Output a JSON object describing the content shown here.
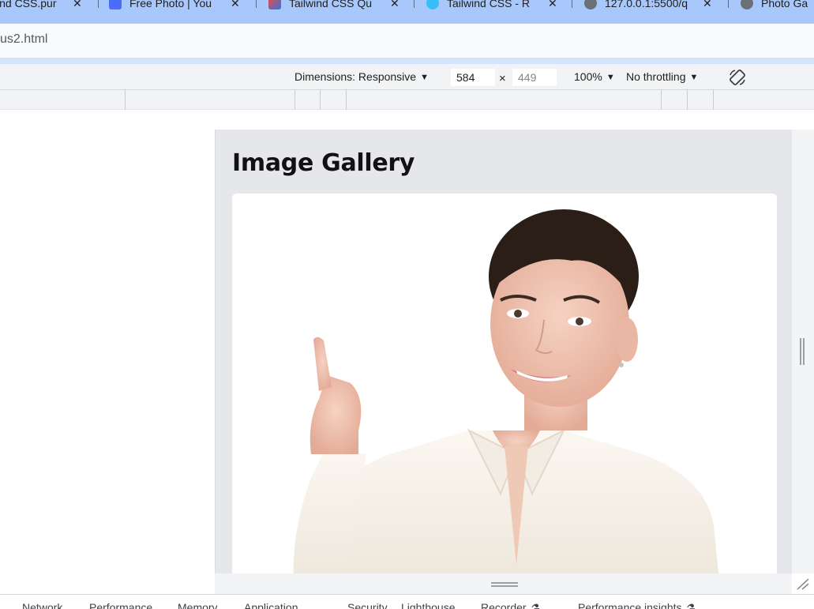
{
  "browser": {
    "tabs": [
      {
        "label": "ind CSS.pur",
        "favicon": "none"
      },
      {
        "label": "Free Photo | You",
        "favicon": "freepik"
      },
      {
        "label": "Tailwind CSS Qu",
        "favicon": "tailwind-quiz"
      },
      {
        "label": "Tailwind CSS - R",
        "favicon": "tailwind"
      },
      {
        "label": "127.0.0.1:5500/q",
        "favicon": "globe"
      },
      {
        "label": "Photo Ga",
        "favicon": "globe"
      }
    ],
    "url": "us2.html"
  },
  "device_toolbar": {
    "dimensions_label": "Dimensions: Responsive",
    "width": "584",
    "times": "×",
    "height": "449",
    "zoom": "100%",
    "throttling": "No throttling"
  },
  "page": {
    "title": "Image Gallery",
    "image_subject": "woman pointing up"
  },
  "devtools_tabs": [
    "Network",
    "Performance",
    "Memory",
    "Application",
    "Security",
    "Lighthouse",
    "Recorder",
    "Performance insights"
  ],
  "colors": {
    "tab_strip": "#a8c7fa",
    "device_background": "#e5e7eb",
    "card_background": "#ffffff"
  }
}
